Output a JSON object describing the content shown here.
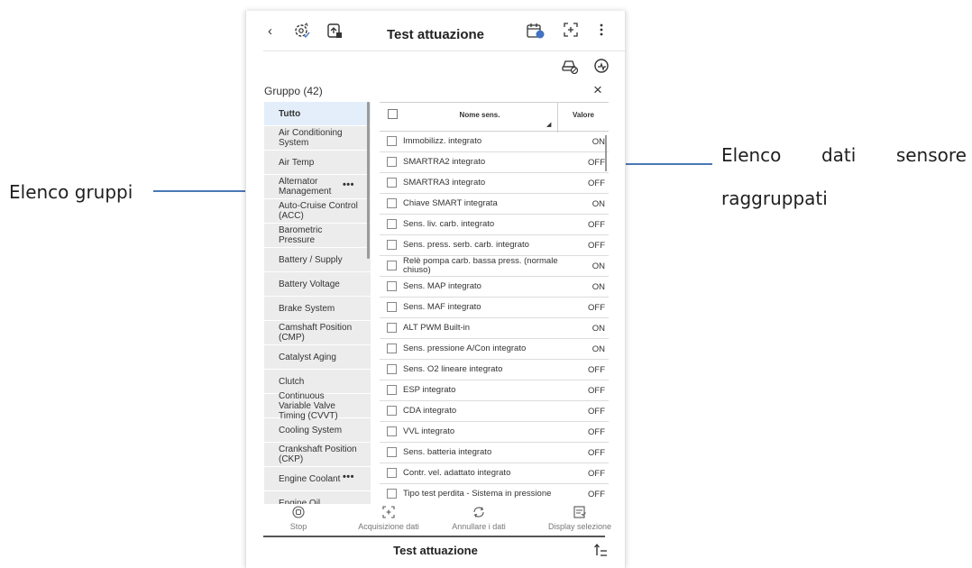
{
  "annotations": {
    "left": "Elenco gruppi",
    "right_line1_word1": "Elenco",
    "right_line1_word2": "dati",
    "right_line1_word3": "sensore",
    "right_line2": "raggruppati"
  },
  "topbar": {
    "back_icon": "‹",
    "title": "Test attuazione"
  },
  "group_panel": {
    "title": "Gruppo (42)",
    "close_icon": "×",
    "items": [
      {
        "label": "Tutto",
        "selected": true
      },
      {
        "label": "Air Conditioning System"
      },
      {
        "label": "Air Temp"
      },
      {
        "label": "Alternator Management",
        "more": "•••"
      },
      {
        "label": "Auto-Cruise Control (ACC)"
      },
      {
        "label": "Barometric Pressure"
      },
      {
        "label": "Battery / Supply"
      },
      {
        "label": "Battery Voltage"
      },
      {
        "label": "Brake System"
      },
      {
        "label": "Camshaft Position (CMP)"
      },
      {
        "label": "Catalyst Aging"
      },
      {
        "label": "Clutch"
      },
      {
        "label": "Continuous Variable Valve Timing (CVVT)"
      },
      {
        "label": "Cooling System"
      },
      {
        "label": "Crankshaft Position (CKP)"
      },
      {
        "label": "Engine Coolant",
        "more": "•••"
      },
      {
        "label": "Engine Oil"
      }
    ]
  },
  "table": {
    "header_name": "Nome sens.",
    "header_value": "Valore",
    "sort_icon": "◢",
    "rows": [
      {
        "name": "Immobilizz. integrato",
        "value": "ON"
      },
      {
        "name": "SMARTRA2 integrato",
        "value": "OFF"
      },
      {
        "name": "SMARTRA3 integrato",
        "value": "OFF"
      },
      {
        "name": "Chiave SMART integrata",
        "value": "ON"
      },
      {
        "name": "Sens. liv. carb. integrato",
        "value": "OFF"
      },
      {
        "name": "Sens. press. serb. carb. integrato",
        "value": "OFF"
      },
      {
        "name": "Relè pompa carb. bassa press. (normale chiuso)",
        "value": "ON"
      },
      {
        "name": "Sens. MAP integrato",
        "value": "ON"
      },
      {
        "name": "Sens. MAF integrato",
        "value": "OFF"
      },
      {
        "name": "ALT PWM Built-in",
        "value": "ON"
      },
      {
        "name": "Sens. pressione A/Con integrato",
        "value": "ON"
      },
      {
        "name": "Sens. O2 lineare integrato",
        "value": "OFF"
      },
      {
        "name": "ESP integrato",
        "value": "OFF"
      },
      {
        "name": "CDA integrato",
        "value": "OFF"
      },
      {
        "name": "VVL integrato",
        "value": "OFF"
      },
      {
        "name": "Sens. batteria integrato",
        "value": "OFF"
      },
      {
        "name": "Contr. vel. adattato integrato",
        "value": "OFF"
      },
      {
        "name": "Tipo test perdita - Sistema in pressione",
        "value": "OFF"
      },
      {
        "name": "",
        "value": ""
      }
    ]
  },
  "actions": {
    "stop": "Stop",
    "acquisition": "Acquisizione dati",
    "undo": "Annullare i dati",
    "display": "Display selezione"
  },
  "bottom": {
    "title": "Test attuazione"
  },
  "colors": {
    "accent": "#4472c4",
    "selected_row": "#e3eefa",
    "list_bg": "#ececec"
  },
  "icons": [
    "back-icon",
    "gear-sync-icon",
    "doc-upload-icon",
    "calendar-icon",
    "capture-icon",
    "more-vertical-icon",
    "car-icon",
    "engine-icon",
    "close-icon",
    "stop-icon",
    "capture-icon",
    "refresh-icon",
    "display-icon",
    "pin-icon"
  ]
}
